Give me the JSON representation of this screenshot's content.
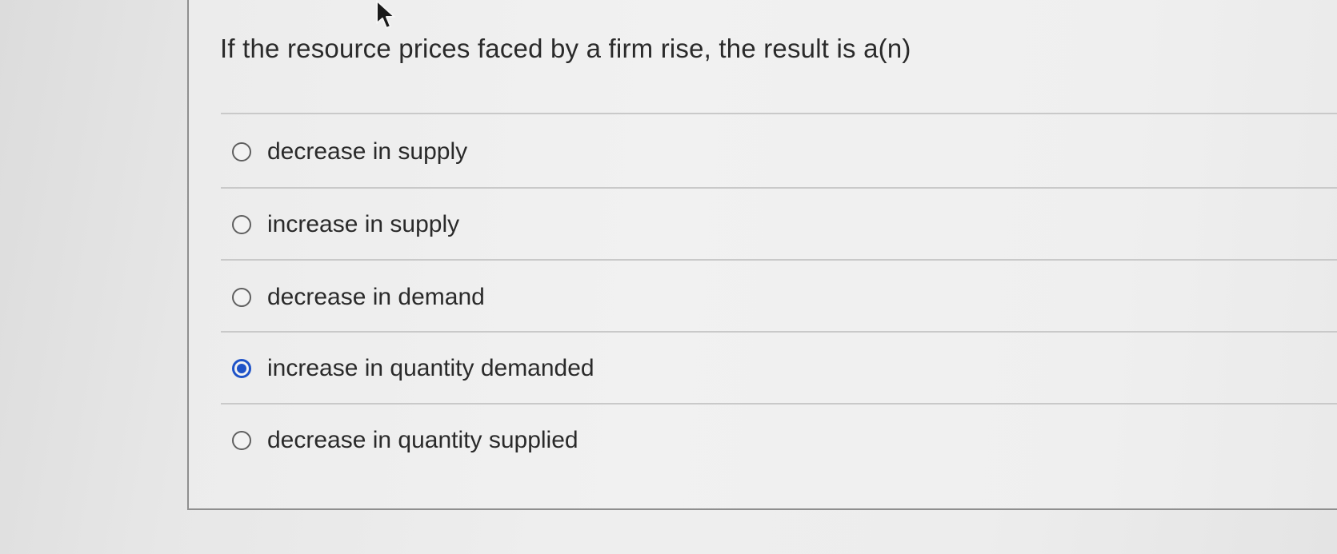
{
  "question": {
    "text": "If the resource prices faced by a firm rise, the result is a(n)"
  },
  "options": [
    {
      "label": "decrease in supply",
      "selected": false
    },
    {
      "label": "increase in supply",
      "selected": false
    },
    {
      "label": "decrease in demand",
      "selected": false
    },
    {
      "label": "increase in quantity demanded",
      "selected": true
    },
    {
      "label": "decrease in quantity supplied",
      "selected": false
    }
  ],
  "colors": {
    "accent": "#1f53c8",
    "text": "#2a2a2a",
    "divider": "#c9c9c9"
  },
  "icons": {
    "cursor": "mouse-pointer-icon",
    "radio": "radio-button-icon"
  }
}
